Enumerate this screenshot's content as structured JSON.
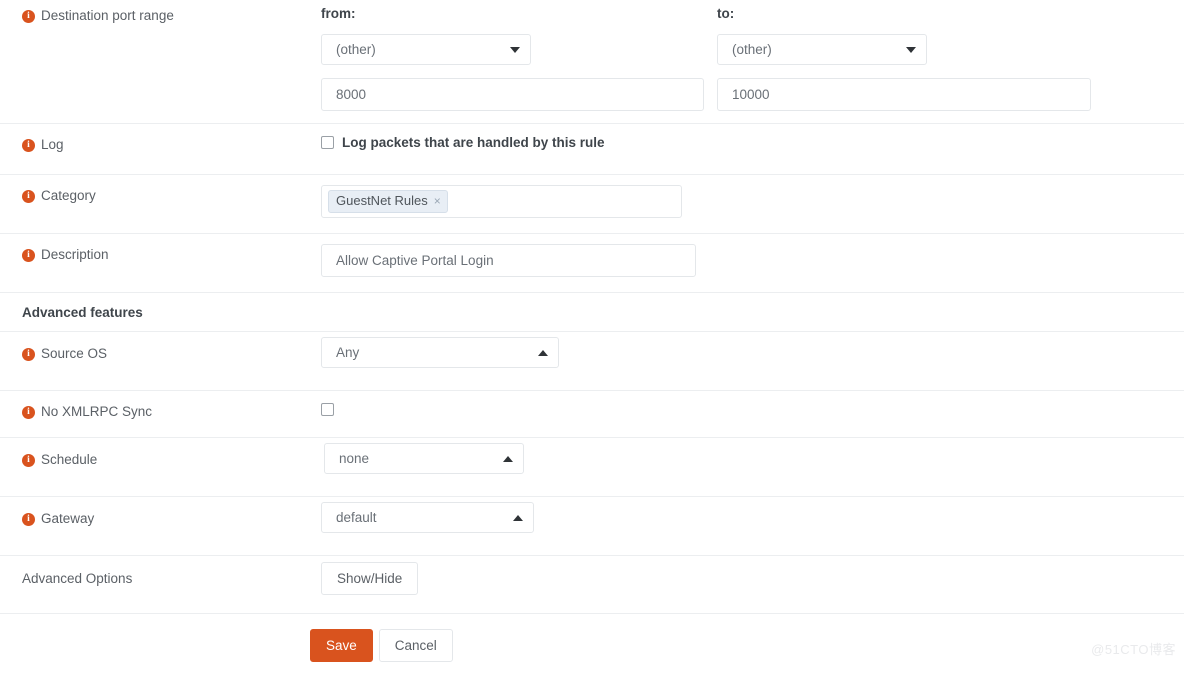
{
  "form": {
    "port_range": {
      "label": "Destination port range",
      "info_icon": "info-icon",
      "from_heading": "from:",
      "to_heading": "to:",
      "from_select_value": "(other)",
      "to_select_value": "(other)",
      "from_port_value": "8000",
      "to_port_value": "10000",
      "from_caret": "chevron-down-icon",
      "to_caret": "chevron-down-icon"
    },
    "log": {
      "label": "Log",
      "checkbox_label": "Log packets that are handled by this rule",
      "checked": false
    },
    "category": {
      "label": "Category",
      "tags": [
        {
          "text": "GuestNet Rules",
          "remove": "×"
        }
      ]
    },
    "description": {
      "label": "Description",
      "value": "Allow Captive Portal Login"
    },
    "advanced_features_heading": "Advanced features",
    "source_os": {
      "label": "Source OS",
      "value": "Any",
      "caret": "chevron-up-icon"
    },
    "no_xmlrpc_sync": {
      "label": "No XMLRPC Sync",
      "checked": false
    },
    "schedule": {
      "label": "Schedule",
      "value": "none",
      "caret": "chevron-up-icon"
    },
    "gateway": {
      "label": "Gateway",
      "value": "default",
      "caret": "chevron-up-icon"
    },
    "advanced_options": {
      "label": "Advanced Options",
      "button_label": "Show/Hide"
    },
    "actions": {
      "save_label": "Save",
      "cancel_label": "Cancel"
    }
  },
  "watermark": "@51CTO博客",
  "colors": {
    "accent": "#d9531e",
    "border": "#e4e7ea",
    "row_divider": "#eceef0",
    "text": "#5b6066",
    "heading": "#3f454b",
    "token_bg": "#e8eef5"
  }
}
